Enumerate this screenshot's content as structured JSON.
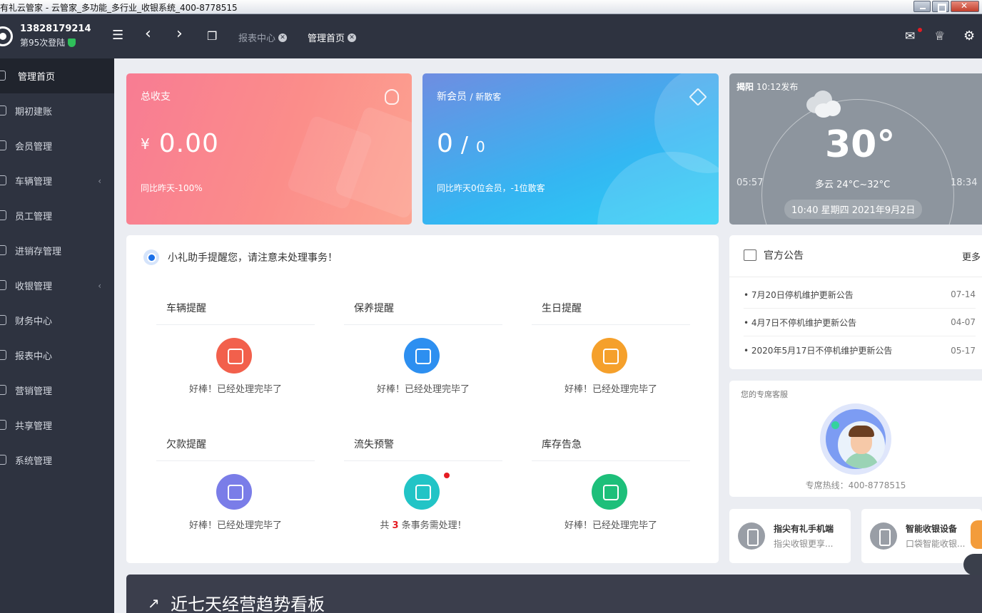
{
  "window": {
    "title": "有礼云管家 - 云管家_多功能_多行业_收银系统_400-8778515"
  },
  "header": {
    "account": "13828179214",
    "login_count": "第95次登陆",
    "tabs": [
      {
        "label": "报表中心"
      },
      {
        "label": "管理首页"
      }
    ]
  },
  "sidebar": {
    "items": [
      {
        "label": "管理首页",
        "active": true
      },
      {
        "label": "期初建账"
      },
      {
        "label": "会员管理"
      },
      {
        "label": "车辆管理",
        "has_sub": true
      },
      {
        "label": "员工管理"
      },
      {
        "label": "进销存管理"
      },
      {
        "label": "收银管理",
        "has_sub": true
      },
      {
        "label": "财务中心"
      },
      {
        "label": "报表中心"
      },
      {
        "label": "营销管理"
      },
      {
        "label": "共享管理"
      },
      {
        "label": "系统管理"
      }
    ]
  },
  "stats": {
    "revenue": {
      "title": "总收支",
      "currency": "¥",
      "value": "0.00",
      "compare": "同比昨天-100%"
    },
    "members": {
      "title": "新会员",
      "title_sub": "/ 新散客",
      "new_members": "0",
      "new_guests": "0",
      "compare": "同比昨天0位会员，-1位散客"
    }
  },
  "weather": {
    "location": "揭阳",
    "published": "10:12发布",
    "temp": "30°",
    "desc": "多云 24°C~32°C",
    "sunrise": "05:57",
    "sunset": "18:34",
    "datetime": "10:40 星期四 2021年9月2日"
  },
  "reminders": {
    "header": "小礼助手提醒您，请注意未处理事务！",
    "items": [
      {
        "title": "车辆提醒",
        "status": "好棒！已经处理完毕了",
        "color": "#f2604c"
      },
      {
        "title": "保养提醒",
        "status": "好棒！已经处理完毕了",
        "color": "#2d8ff0"
      },
      {
        "title": "生日提醒",
        "status": "好棒！已经处理完毕了",
        "color": "#f5a02b"
      },
      {
        "title": "欠款提醒",
        "status": "好棒！已经处理完毕了",
        "color": "#7a7de8"
      },
      {
        "title": "流失预警",
        "status_pre": "共",
        "status_num": "3",
        "status_post": "条事务需处理！",
        "color": "#22c4c6"
      },
      {
        "title": "库存告急",
        "status": "好棒！已经处理完毕了",
        "color": "#1dbf7a"
      }
    ]
  },
  "notice": {
    "title": "官方公告",
    "more": "更多",
    "items": [
      {
        "text": "7月20日停机维护更新公告",
        "date": "07-14"
      },
      {
        "text": "4月7日不停机维护更新公告",
        "date": "04-07"
      },
      {
        "text": "2020年5月17日不停机维护更新公告",
        "date": "05-17"
      }
    ]
  },
  "service": {
    "title": "您的专席客服",
    "hotline": "专席热线：400-8778515"
  },
  "promos": [
    {
      "title": "指尖有礼手机端",
      "desc": "指尖收银更享..."
    },
    {
      "title": "智能收银设备",
      "desc": "口袋智能收银..."
    }
  ],
  "trend": {
    "title": "近七天经营趋势看板"
  }
}
